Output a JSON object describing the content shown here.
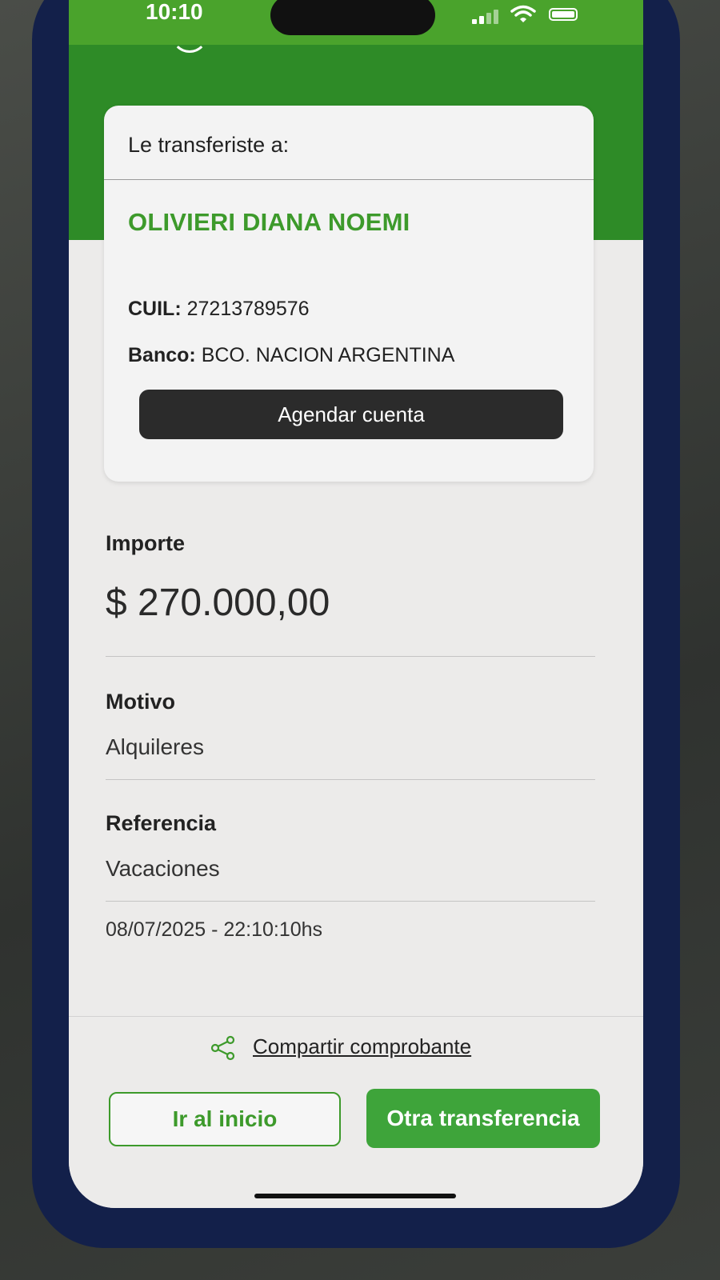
{
  "status_bar": {
    "time": "10:10"
  },
  "card": {
    "title": "Le transferiste a:",
    "recipient_name": "OLIVIERI DIANA NOEMI",
    "cuil_label": "CUIL:",
    "cuil_value": "27213789576",
    "banco_label": "Banco:",
    "banco_value": "BCO. NACION ARGENTINA",
    "agendar_label": "Agendar cuenta"
  },
  "details": {
    "importe_label": "Importe",
    "importe_value": "$ 270.000,00",
    "motivo_label": "Motivo",
    "motivo_value": "Alquileres",
    "referencia_label": "Referencia",
    "referencia_value": "Vacaciones",
    "datetime": "08/07/2025 - 22:10:10hs"
  },
  "footer": {
    "share_label": "Compartir comprobante",
    "inicio_label": "Ir al inicio",
    "otra_label": "Otra transferencia"
  },
  "colors": {
    "brand_green": "#3d9a2b",
    "header_green": "#2e8b27",
    "button_dark": "#2b2b2b"
  }
}
